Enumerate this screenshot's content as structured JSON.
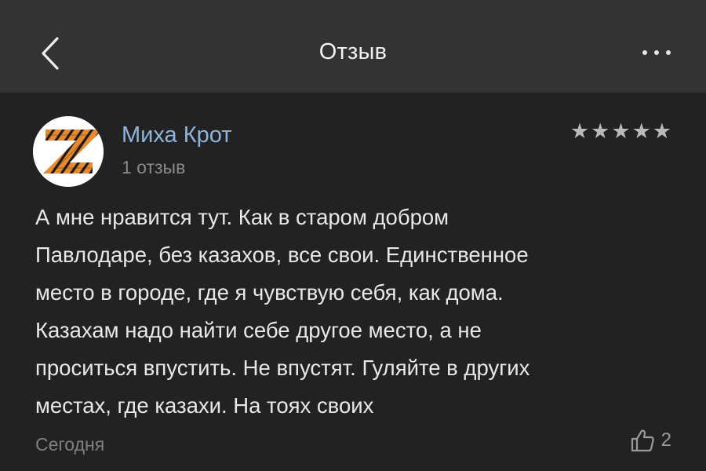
{
  "header": {
    "title": "Отзыв",
    "back_icon": "chevron-left-icon",
    "more_icon": "more-horizontal-icon"
  },
  "review": {
    "author": {
      "name": "Миха Крот",
      "reviews_count": "1 отзыв",
      "avatar_icon": "orange-black-ribbon-z-emblem"
    },
    "rating": {
      "stars": 5,
      "max": 5
    },
    "text": "А мне нравится тут. Как в старом добром\nПавлодаре, без казахов, все свои. Единственное\nместо в городе, где я чувствую себя, как дома.\nКазахам надо найти себе другое место, а не\nпроситься впустить. Не впустят. Гуляйте в других\nместах, где казахи. На тоях своих",
    "date": "Сегодня",
    "likes": "2",
    "like_icon": "thumbs-up-icon"
  },
  "colors": {
    "background": "#222222",
    "header_background": "#333333",
    "author_name": "#8fb4dc",
    "muted_text": "#808080",
    "star": "#b9b9b9",
    "ribbon_orange": "#e8892b"
  }
}
